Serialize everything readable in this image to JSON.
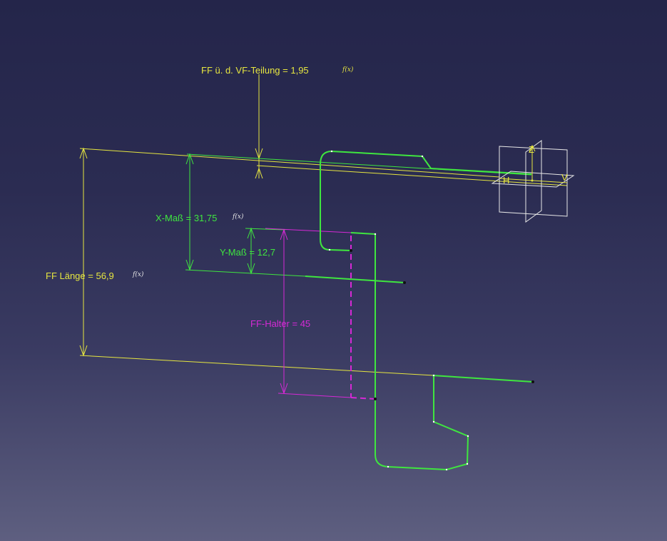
{
  "colors": {
    "yellow": "#e6e640",
    "green": "#3fe63f",
    "magenta": "#d629d6",
    "white": "#e8e8e8",
    "endpoint": "#101010"
  },
  "dimensions": {
    "ff_vf": {
      "text": "FF ü. d. VF-Teilung = 1,95",
      "formula_icon": "f(x)",
      "color": "yellow"
    },
    "x_mass": {
      "text": "X-Maß = 31,75",
      "formula_icon": "f(x)",
      "color": "green"
    },
    "y_mass": {
      "text": "Y-Maß = 12,7",
      "color": "green"
    },
    "ff_laenge": {
      "text": "FF Länge = 56,9",
      "formula_icon": "f(x)",
      "color": "yellow"
    },
    "ff_halter": {
      "text": "FF-Halter = 45",
      "color": "magenta"
    }
  },
  "axis_labels": {
    "z": "Z",
    "h": "H",
    "v": "V"
  }
}
